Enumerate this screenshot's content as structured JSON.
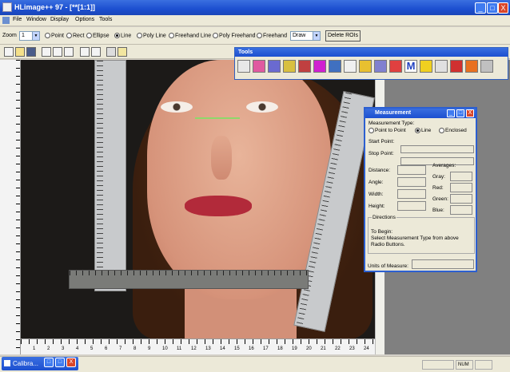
{
  "window": {
    "title": "HLimage++ 97 - [**[1:1]]"
  },
  "titlebar_buttons": [
    "_",
    "□",
    "X"
  ],
  "menu": [
    "File",
    "Window",
    "Display",
    "Options",
    "Tools"
  ],
  "shapebar": {
    "zoom_label": "Zoom",
    "zoom_value": "1",
    "shapes": [
      {
        "label": "Point",
        "selected": false
      },
      {
        "label": "Rect",
        "selected": false
      },
      {
        "label": "Ellipse",
        "selected": false
      },
      {
        "label": "Line",
        "selected": true
      },
      {
        "label": "Poly Line",
        "selected": false
      },
      {
        "label": "Freehand Line",
        "selected": false
      },
      {
        "label": "Poly Freehand",
        "selected": false
      },
      {
        "label": "Freehand",
        "selected": false
      }
    ],
    "mode_value": "Draw",
    "delete_button": "Delete ROIs"
  },
  "tools_window": {
    "title": "Tools",
    "m_tool": "M"
  },
  "measurement": {
    "title": "Measurement",
    "type_label": "Measurement Type:",
    "types": [
      {
        "label": "Point to Point",
        "selected": false
      },
      {
        "label": "Line",
        "selected": true
      },
      {
        "label": "Enclosed",
        "selected": false
      }
    ],
    "start_point": "Start Point:",
    "stop_point": "Stop Point:",
    "distance": "Distance:",
    "angle": "Angle:",
    "width": "Width:",
    "height": "Height:",
    "averages": "Averages:",
    "gray": "Gray:",
    "red": "Red:",
    "green": "Green:",
    "blue": "Blue:",
    "directions": "Directions",
    "directions_text": "To Begin:\nSelect Measurement Type from above\nRadio Buttons.",
    "units": "Units of Measure:"
  },
  "ruler_numbers": [
    "1",
    "2",
    "3",
    "4",
    "5",
    "6",
    "7",
    "8",
    "9",
    "10",
    "11",
    "12",
    "13",
    "14",
    "15",
    "16",
    "17",
    "18",
    "19",
    "20",
    "21",
    "22",
    "23",
    "24"
  ],
  "taskbar": {
    "item": "Calibra..."
  },
  "status": {
    "num": "NUM"
  }
}
